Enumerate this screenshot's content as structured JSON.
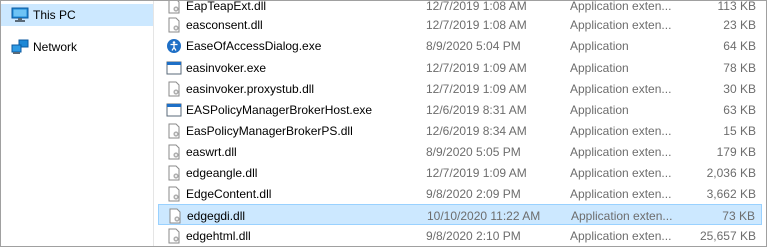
{
  "nav": {
    "items": [
      {
        "label": "This PC",
        "icon": "this-pc-icon",
        "selected": true
      },
      {
        "label": "Network",
        "icon": "network-icon",
        "selected": false
      }
    ]
  },
  "files": [
    {
      "name": "EapTeapExt.dll",
      "date": "12/7/2019 1:08 AM",
      "type": "Application exten...",
      "size": "113 KB",
      "icon": "dll-file-icon"
    },
    {
      "name": "easconsent.dll",
      "date": "12/7/2019 1:08 AM",
      "type": "Application exten...",
      "size": "23 KB",
      "icon": "dll-file-icon"
    },
    {
      "name": "EaseOfAccessDialog.exe",
      "date": "8/9/2020 5:04 PM",
      "type": "Application",
      "size": "64 KB",
      "icon": "ease-of-access-icon"
    },
    {
      "name": "easinvoker.exe",
      "date": "12/7/2019 1:09 AM",
      "type": "Application",
      "size": "78 KB",
      "icon": "exe-window-icon"
    },
    {
      "name": "easinvoker.proxystub.dll",
      "date": "12/7/2019 1:09 AM",
      "type": "Application exten...",
      "size": "30 KB",
      "icon": "dll-file-icon"
    },
    {
      "name": "EASPolicyManagerBrokerHost.exe",
      "date": "12/6/2019 8:31 AM",
      "type": "Application",
      "size": "63 KB",
      "icon": "exe-window-icon"
    },
    {
      "name": "EasPolicyManagerBrokerPS.dll",
      "date": "12/6/2019 8:34 AM",
      "type": "Application exten...",
      "size": "15 KB",
      "icon": "dll-file-icon"
    },
    {
      "name": "easwrt.dll",
      "date": "8/9/2020 5:05 PM",
      "type": "Application exten...",
      "size": "179 KB",
      "icon": "dll-file-icon"
    },
    {
      "name": "edgeangle.dll",
      "date": "12/7/2019 1:09 AM",
      "type": "Application exten...",
      "size": "2,036 KB",
      "icon": "dll-file-icon"
    },
    {
      "name": "EdgeContent.dll",
      "date": "9/8/2020 2:09 PM",
      "type": "Application exten...",
      "size": "3,662 KB",
      "icon": "dll-file-icon"
    },
    {
      "name": "edgegdi.dll",
      "date": "10/10/2020 11:22 AM",
      "type": "Application exten...",
      "size": "73 KB",
      "icon": "dll-file-icon",
      "selected": true
    },
    {
      "name": "edgehtml.dll",
      "date": "9/8/2020 2:10 PM",
      "type": "Application exten...",
      "size": "25,657 KB",
      "icon": "dll-file-icon"
    }
  ]
}
